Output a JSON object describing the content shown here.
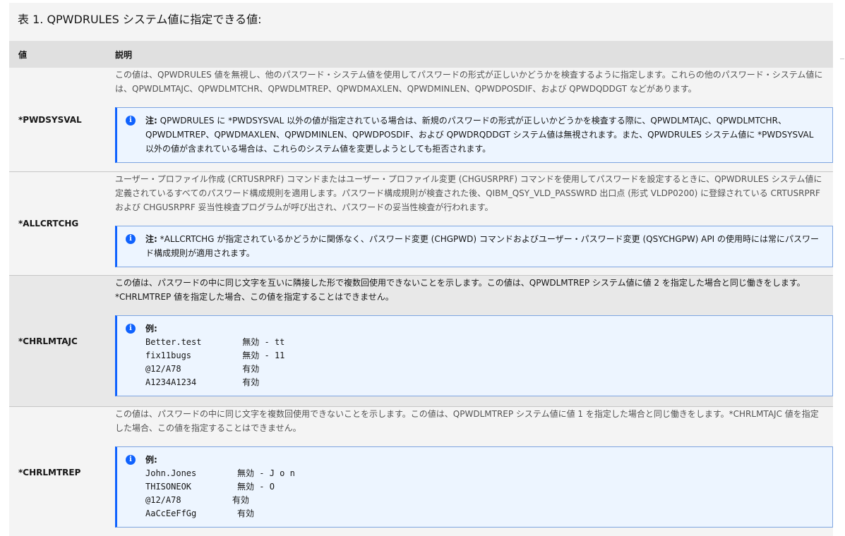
{
  "table": {
    "caption": "表 1. QPWDRULES システム値に指定できる値:",
    "header_value": "値",
    "header_desc": "説明",
    "rows": [
      {
        "value": "*PWDSYSVAL",
        "desc": "この値は、QPWDRULES 値を無視し、他のパスワード・システム値を使用してパスワードの形式が正しいかどうかを検査するように指定します。これらの他のパスワード・システム値には、QPWDLMTAJC、QPWDLMTCHR、QPWDLMTREP、QPWDMAXLEN、QPWDMINLEN、QPWDPOSDIF、および QPWDQDDGT などがあります。",
        "note_label": "注:",
        "note_text": "QPWDRULES に *PWDSYSVAL 以外の値が指定されている場合は、新規のパスワードの形式が正しいかどうかを検査する際に、QPWDLMTAJC、QPWDLMTCHR、QPWDLMTREP、QPWDMAXLEN、QPWDMINLEN、QPWDPOSDIF、および QPWDRQDDGT システム値は無視されます。また、QPWDRULES システム値に *PWDSYSVAL 以外の値が含まれている場合は、これらのシステム値を変更しようとしても拒否されます。"
      },
      {
        "value": "*ALLCRTCHG",
        "desc": "ユーザー・プロファイル作成 (CRTUSRPRF) コマンドまたはユーザー・プロファイル変更 (CHGUSRPRF) コマンドを使用してパスワードを設定するときに、QPWDRULES システム値に定義されているすべてのパスワード構成規則を適用します。パスワード構成規則が検査された後、QIBM_QSY_VLD_PASSWRD 出口点 (形式 VLDP0200) に登録されている CRTUSRPRF および CHGUSRPRF 妥当性検査プログラムが呼び出され、パスワードの妥当性検査が行われます。",
        "note_label": "注:",
        "note_text": "*ALLCRTCHG が指定されているかどうかに関係なく、パスワード変更 (CHGPWD) コマンドおよびユーザー・パスワード変更 (QSYCHGPW) API の使用時には常にパスワード構成規則が適用されます。"
      },
      {
        "value": "*CHRLMTAJC",
        "desc": "この値は、パスワードの中に同じ文字を互いに隣接した形で複数回使用できないことを示します。この値は、QPWDLMTREP システム値に値 2 を指定した場合と同じ働きをします。*CHRLMTREP 値を指定した場合、この値を指定することはできません。",
        "example_label": "例:",
        "examples": [
          "Better.test        無効 - tt",
          "fix11bugs          無効 - 11",
          "@12/A78            有効",
          "A1234A1234         有効"
        ]
      },
      {
        "value": "*CHRLMTREP",
        "desc": "この値は、パスワードの中に同じ文字を複数回使用できないことを示します。この値は、QPWDLMTREP システム値に値 1 を指定した場合と同じ働きをします。*CHRLMTAJC 値を指定した場合、この値を指定することはできません。",
        "example_label": "例:",
        "examples": [
          "John.Jones        無効 - J o n",
          "THISONEOK         無効 - O",
          "@12/A78          有効",
          "AaCcEeFfGg        有効"
        ]
      }
    ]
  },
  "colors": {
    "note_border": "#0f62fe",
    "note_bg": "#edf5ff",
    "header_bg": "#e0e0e0",
    "row_bg": "#f4f4f4"
  }
}
